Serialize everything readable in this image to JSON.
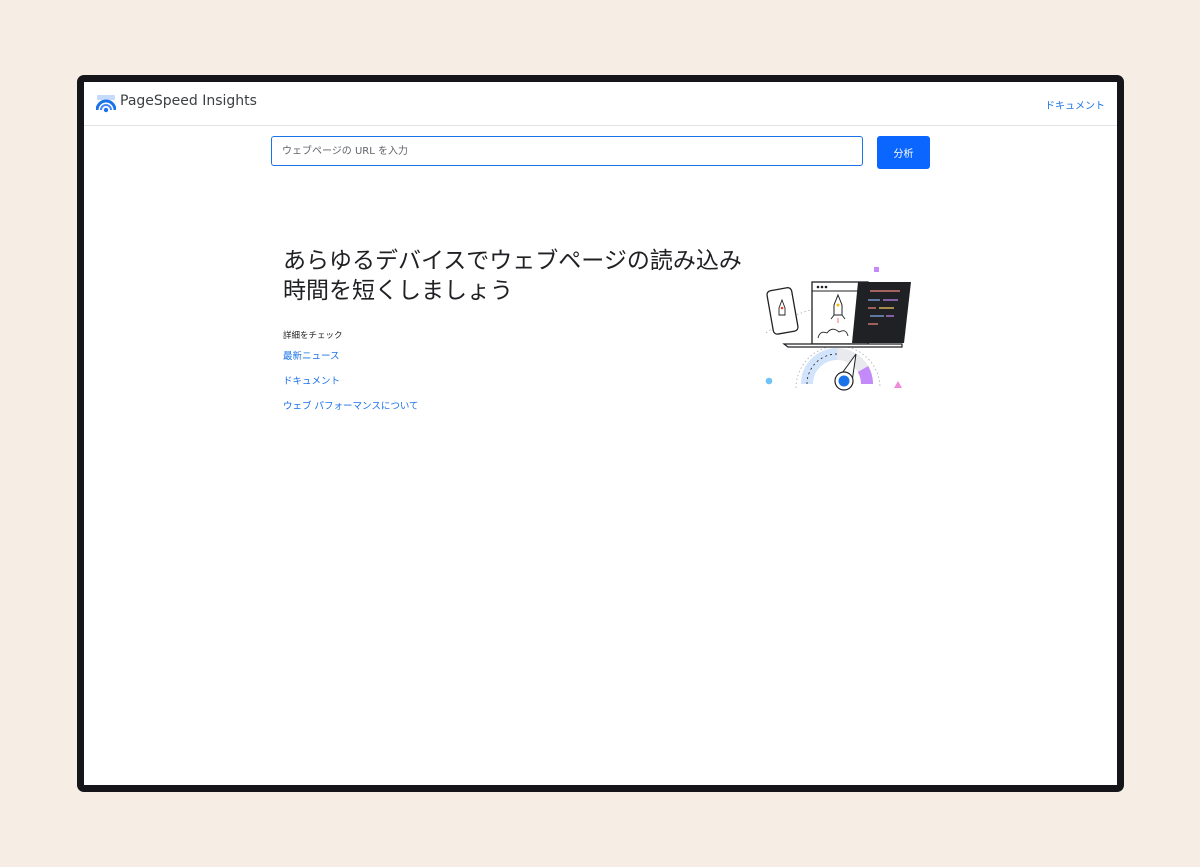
{
  "header": {
    "app_title": "PageSpeed Insights",
    "docs_link": "ドキュメント"
  },
  "search": {
    "placeholder": "ウェブページの URL を入力",
    "value": "",
    "button_label": "分析"
  },
  "hero": {
    "headline": "あらゆるデバイスでウェブページの読み込み時間を短くしましょう"
  },
  "learn_more": {
    "title": "詳細をチェック",
    "links": [
      "最新ニュース",
      "ドキュメント",
      "ウェブ パフォーマンスについて"
    ]
  },
  "colors": {
    "accent": "#1a73e8",
    "button": "#0b66ff",
    "page_background": "#f6eee5",
    "frame": "#16161a"
  },
  "icons": {
    "logo": "pagespeed-gauge-logo",
    "illustration": "devices-rocket-gauge-illustration"
  }
}
